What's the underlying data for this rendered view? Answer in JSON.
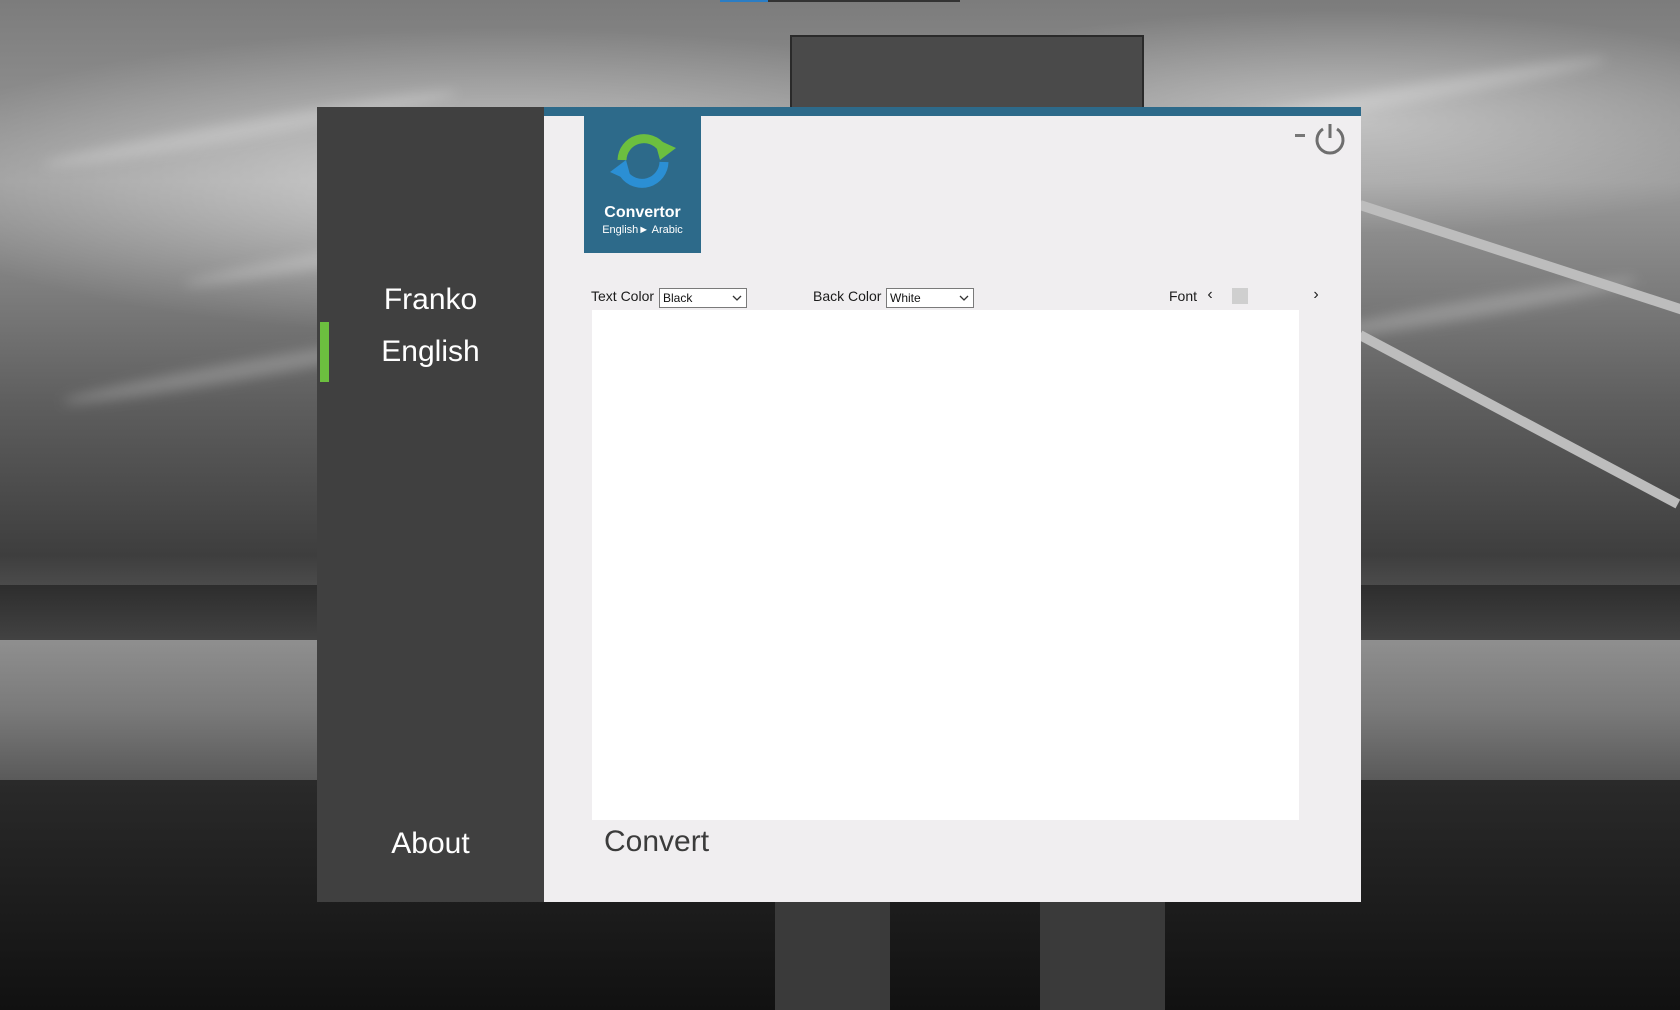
{
  "sidebar": {
    "items": [
      {
        "label": "Franko",
        "active": false
      },
      {
        "label": "English",
        "active": true
      }
    ],
    "about_label": "About"
  },
  "logo": {
    "icon": "refresh-arrows-icon",
    "title": "Convertor",
    "subtitle": "English► Arabic"
  },
  "window_controls": {
    "minimize_icon": "minimize-icon",
    "power_icon": "power-icon"
  },
  "toolbar": {
    "text_color_label": "Text Color",
    "text_color_value": "Black",
    "back_color_label": "Back Color",
    "back_color_value": "White",
    "font_label": "Font",
    "font_prev": "‹",
    "font_next": "›"
  },
  "editor": {
    "value": ""
  },
  "convert_label": "Convert",
  "colors": {
    "sidebar_bg": "#404040",
    "active_indicator": "#6cbf3f",
    "accent": "#2d6a8a",
    "main_bg": "#f0eef0"
  }
}
